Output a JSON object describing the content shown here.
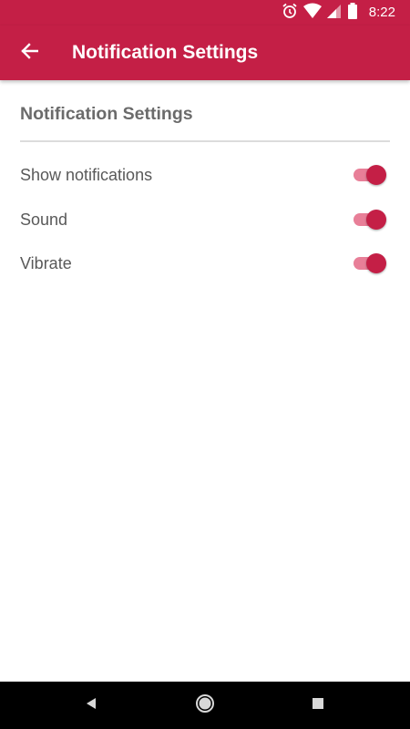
{
  "status_bar": {
    "time": "8:22",
    "icons": [
      "alarm-icon",
      "wifi-icon",
      "signal-icon",
      "battery-icon"
    ]
  },
  "app_bar": {
    "title": "Notification Settings",
    "back_icon": "arrow-back-icon"
  },
  "section": {
    "title": "Notification Settings"
  },
  "settings": [
    {
      "label": "Show notifications",
      "enabled": true
    },
    {
      "label": "Sound",
      "enabled": true
    },
    {
      "label": "Vibrate",
      "enabled": true
    }
  ],
  "nav_bar": {
    "buttons": [
      "back-triangle-icon",
      "home-circle-icon",
      "recents-square-icon"
    ]
  },
  "colors": {
    "primary": "#c41f46",
    "switch_track": "#e87f98",
    "section_text": "#6b6b6b",
    "label_text": "#595959"
  }
}
